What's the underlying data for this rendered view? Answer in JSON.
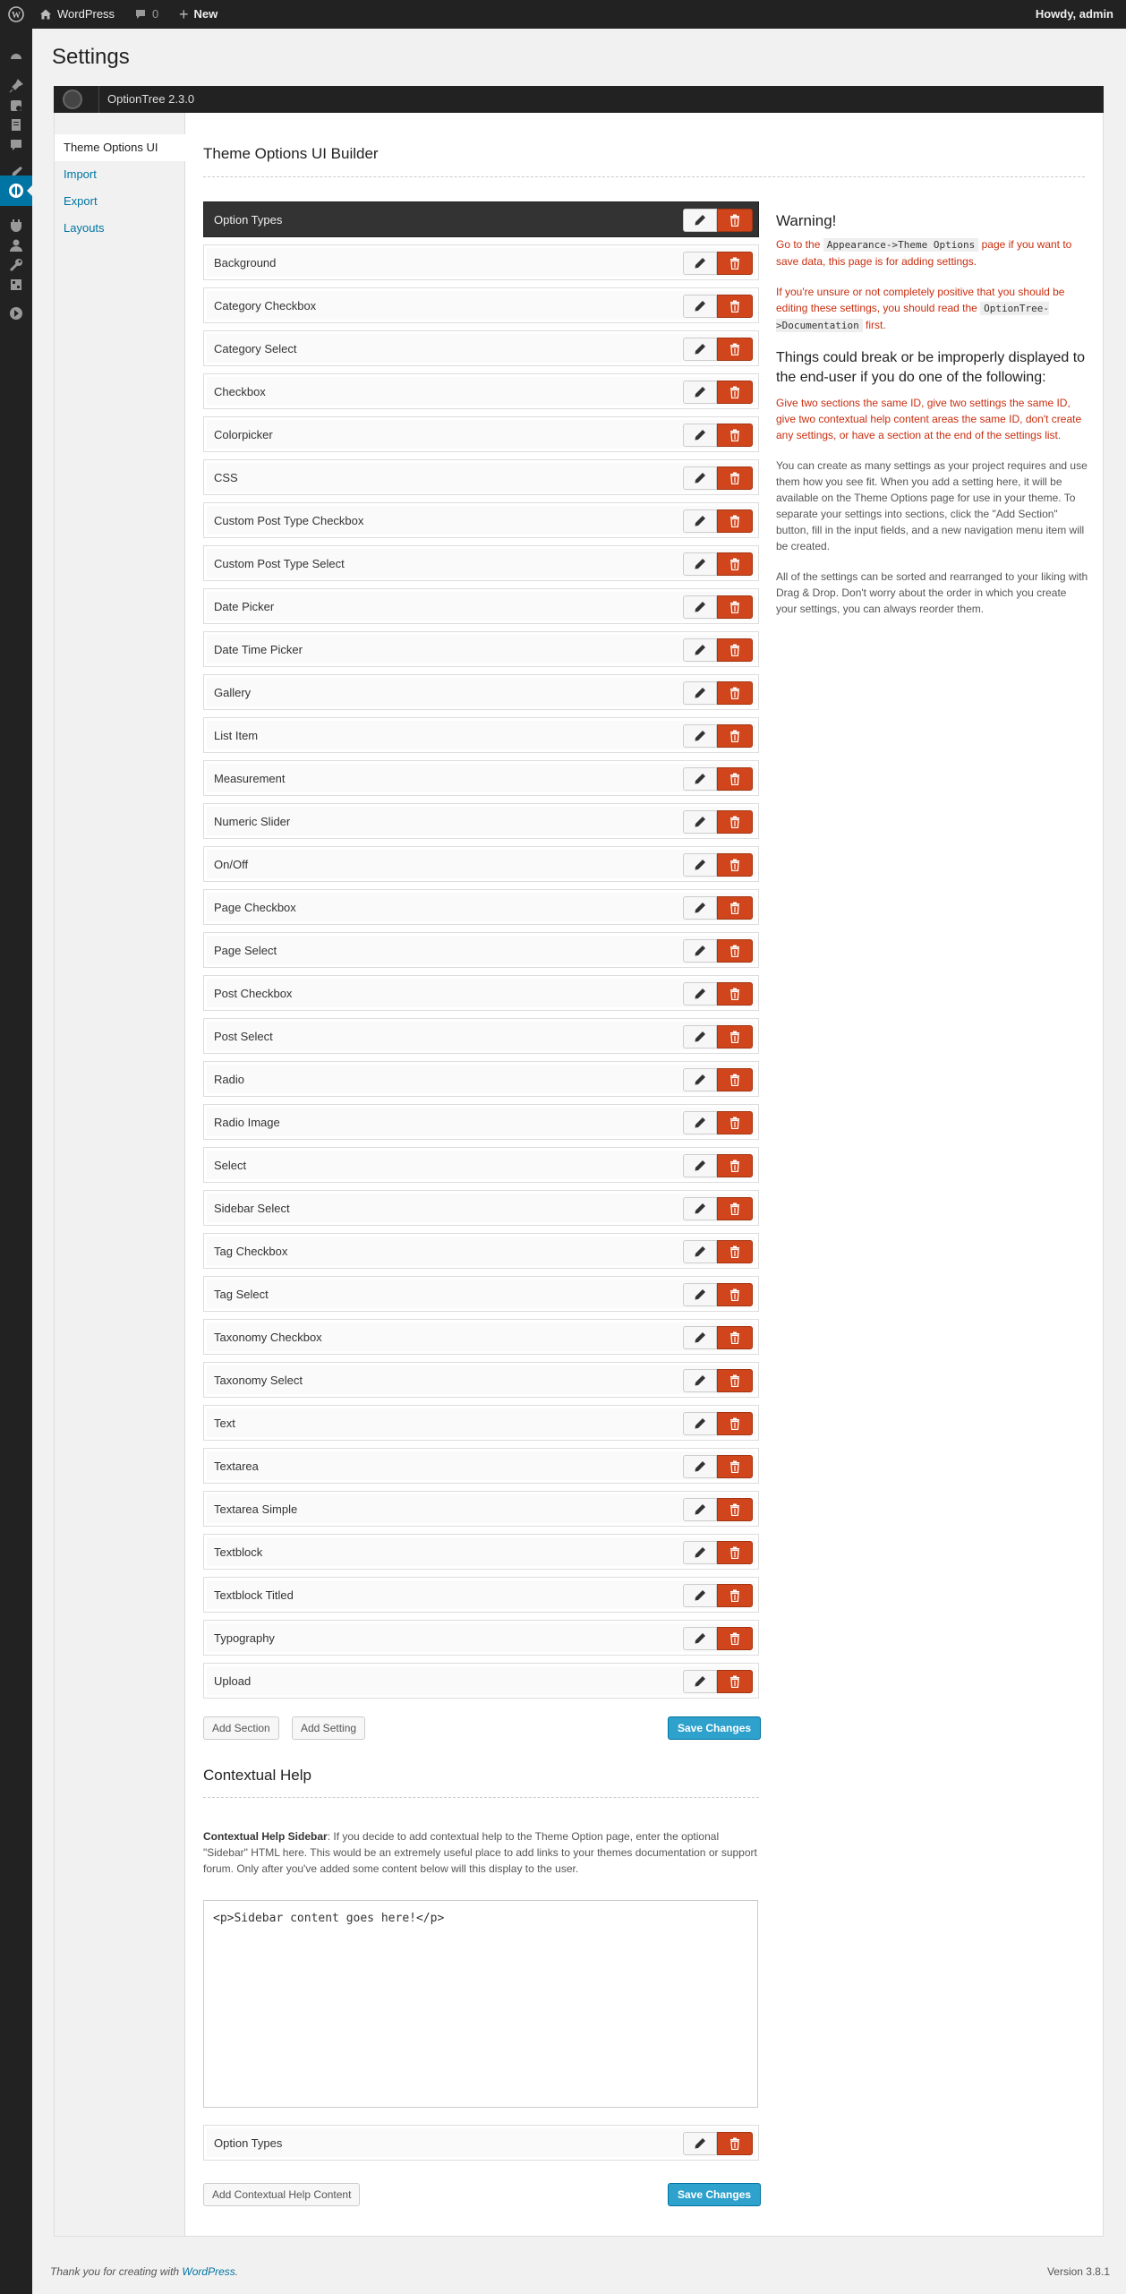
{
  "adminbar": {
    "site_name": "WordPress",
    "comments_count": "0",
    "new_label": "New",
    "howdy": "Howdy, admin"
  },
  "page": {
    "title": "Settings"
  },
  "optiontree": {
    "version_label": "OptionTree 2.3.0",
    "nav": [
      {
        "label": "Theme Options UI",
        "active": true
      },
      {
        "label": "Import"
      },
      {
        "label": "Export"
      },
      {
        "label": "Layouts"
      }
    ]
  },
  "builder": {
    "title": "Theme Options UI Builder",
    "section_label": "Option Types",
    "settings": [
      "Background",
      "Category Checkbox",
      "Category Select",
      "Checkbox",
      "Colorpicker",
      "CSS",
      "Custom Post Type Checkbox",
      "Custom Post Type Select",
      "Date Picker",
      "Date Time Picker",
      "Gallery",
      "List Item",
      "Measurement",
      "Numeric Slider",
      "On/Off",
      "Page Checkbox",
      "Page Select",
      "Post Checkbox",
      "Post Select",
      "Radio",
      "Radio Image",
      "Select",
      "Sidebar Select",
      "Tag Checkbox",
      "Tag Select",
      "Taxonomy Checkbox",
      "Taxonomy Select",
      "Text",
      "Textarea",
      "Textarea Simple",
      "Textblock",
      "Textblock Titled",
      "Typography",
      "Upload"
    ],
    "add_section_label": "Add Section",
    "add_setting_label": "Add Setting",
    "save_label": "Save Changes"
  },
  "contextual_help": {
    "title": "Contextual Help",
    "sidebar_label": "Contextual Help Sidebar",
    "sidebar_desc": ": If you decide to add contextual help to the Theme Option page, enter the optional \"Sidebar\" HTML here. This would be an extremely useful place to add links to your themes documentation or support forum. Only after you've added some content below will this display to the user.",
    "sidebar_value": "<p>Sidebar content goes here!</p>",
    "content_item_label": "Option Types",
    "add_content_label": "Add Contextual Help Content",
    "save_label": "Save Changes"
  },
  "warning": {
    "title": "Warning!",
    "p1_a": "Go to the ",
    "p1_code": "Appearance->Theme Options",
    "p1_b": " page if you want to save data, this page is for adding settings.",
    "p2_a": "If you're unsure or not completely positive that you should be editing these settings, you should read the ",
    "p2_code": "OptionTree->Documentation",
    "p2_b": " first.",
    "h2": "Things could break or be improperly displayed to the end-user if you do one of the following:",
    "p3": "Give two sections the same ID, give two settings the same ID, give two contextual help content areas the same ID, don't create any settings, or have a section at the end of the settings list.",
    "p4": "You can create as many settings as your project requires and use them how you see fit. When you add a setting here, it will be available on the Theme Options page for use in your theme. To separate your settings into sections, click the \"Add Section\" button, fill in the input fields, and a new navigation menu item will be created.",
    "p5": "All of the settings can be sorted and rearranged to your liking with Drag & Drop. Don't worry about the order in which you create your settings, you can always reorder them."
  },
  "footer": {
    "thanks_a": "Thank you for creating with ",
    "thanks_link": "WordPress",
    "thanks_b": ".",
    "version": "Version 3.8.1"
  },
  "colors": {
    "accent": "#2ea2cc",
    "danger": "#d0451b",
    "admin_dark": "#222222",
    "link": "#0074a2"
  }
}
